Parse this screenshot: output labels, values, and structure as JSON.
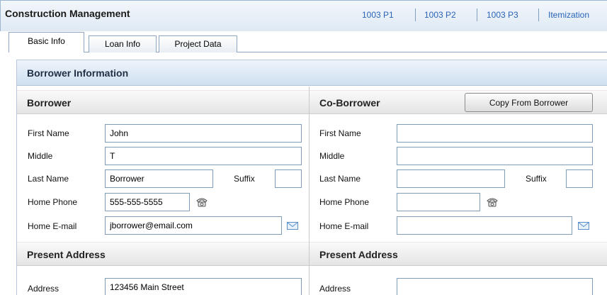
{
  "header": {
    "title": "Construction Management",
    "links": [
      "1003 P1",
      "1003 P2",
      "1003 P3",
      "Itemization"
    ]
  },
  "tabs": [
    {
      "label": "Basic Info",
      "active": true
    },
    {
      "label": "Loan Info",
      "active": false
    },
    {
      "label": "Project Data",
      "active": false
    }
  ],
  "panel": {
    "title": "Borrower Information"
  },
  "borrower": {
    "section_title": "Borrower",
    "labels": {
      "first_name": "First Name",
      "middle": "Middle",
      "last_name": "Last Name",
      "suffix": "Suffix",
      "home_phone": "Home Phone",
      "home_email": "Home E-mail"
    },
    "values": {
      "first_name": "John",
      "middle": "T",
      "last_name": "Borrower",
      "suffix": "",
      "home_phone": "555-555-5555",
      "home_email": "jborrower@email.com"
    },
    "address_section_title": "Present Address",
    "address_label": "Address",
    "address_value": "123456 Main Street"
  },
  "coborrower": {
    "section_title": "Co-Borrower",
    "copy_button": "Copy From Borrower",
    "labels": {
      "first_name": "First Name",
      "middle": "Middle",
      "last_name": "Last Name",
      "suffix": "Suffix",
      "home_phone": "Home Phone",
      "home_email": "Home E-mail"
    },
    "values": {
      "first_name": "",
      "middle": "",
      "last_name": "",
      "suffix": "",
      "home_phone": "",
      "home_email": ""
    },
    "address_section_title": "Present Address",
    "address_label": "Address",
    "address_value": ""
  },
  "icons": {
    "phone": "telephone-icon",
    "email": "envelope-icon"
  },
  "colors": {
    "link": "#2a63b8",
    "header_bg": "#dfe9f4",
    "input_border": "#7f9db9"
  }
}
